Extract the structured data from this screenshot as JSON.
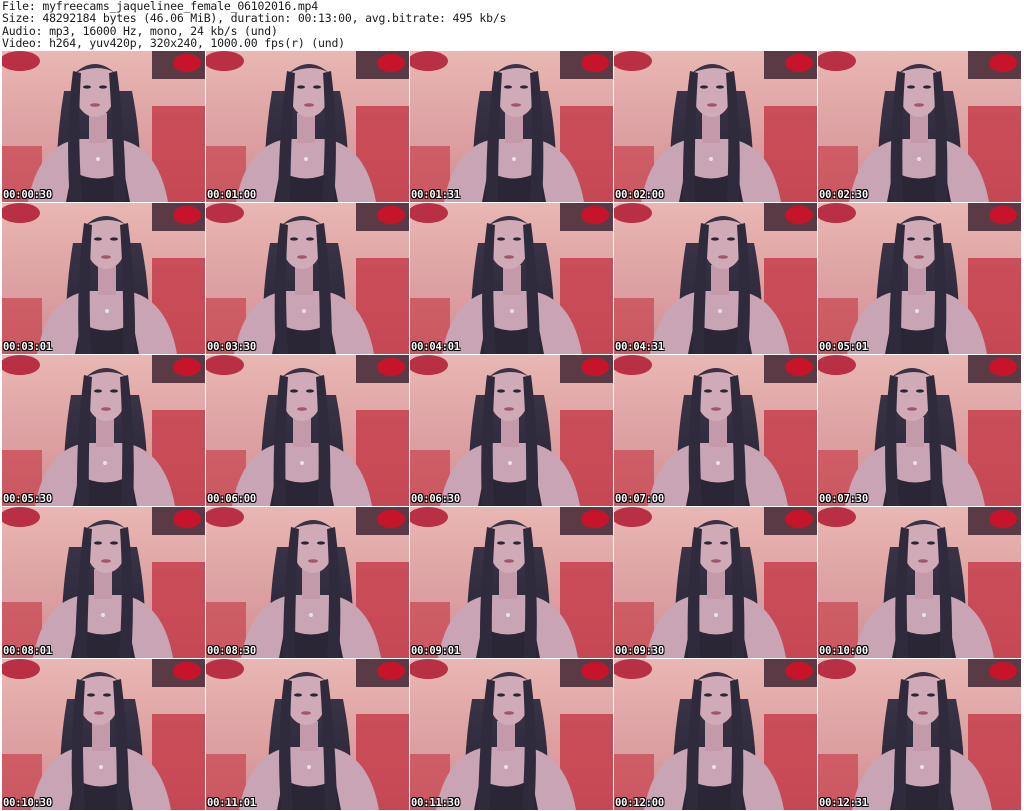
{
  "header": {
    "file_line": "File: myfreecams_jaquelinee_female_06102016.mp4",
    "size_line": "Size: 48292184 bytes (46.06 MiB), duration: 00:13:00, avg.bitrate: 495 kb/s",
    "audio_line": "Audio: mp3, 16000 Hz, mono, 24 kb/s (und)",
    "video_line": "Video: h264, yuv420p, 320x240, 1000.00 fps(r) (und)"
  },
  "thumbnails": [
    {
      "timestamp": "00:00:30"
    },
    {
      "timestamp": "00:01:00"
    },
    {
      "timestamp": "00:01:31"
    },
    {
      "timestamp": "00:02:00"
    },
    {
      "timestamp": "00:02:30"
    },
    {
      "timestamp": "00:03:01"
    },
    {
      "timestamp": "00:03:30"
    },
    {
      "timestamp": "00:04:01"
    },
    {
      "timestamp": "00:04:31"
    },
    {
      "timestamp": "00:05:01"
    },
    {
      "timestamp": "00:05:30"
    },
    {
      "timestamp": "00:06:00"
    },
    {
      "timestamp": "00:06:30"
    },
    {
      "timestamp": "00:07:00"
    },
    {
      "timestamp": "00:07:30"
    },
    {
      "timestamp": "00:08:01"
    },
    {
      "timestamp": "00:08:30"
    },
    {
      "timestamp": "00:09:01"
    },
    {
      "timestamp": "00:09:30"
    },
    {
      "timestamp": "00:10:00"
    },
    {
      "timestamp": "00:10:30"
    },
    {
      "timestamp": "00:11:01"
    },
    {
      "timestamp": "00:11:30"
    },
    {
      "timestamp": "00:12:00"
    },
    {
      "timestamp": "00:12:31"
    }
  ],
  "colors": {
    "background": "#ffffff",
    "text": "#1a1a1a",
    "timestamp": "#ffffff",
    "wall_pink": "#e3a9a8",
    "pillow_red": "#c8142a",
    "hair_dark": "#2b2a3a",
    "skin": "#c9a3b0"
  }
}
